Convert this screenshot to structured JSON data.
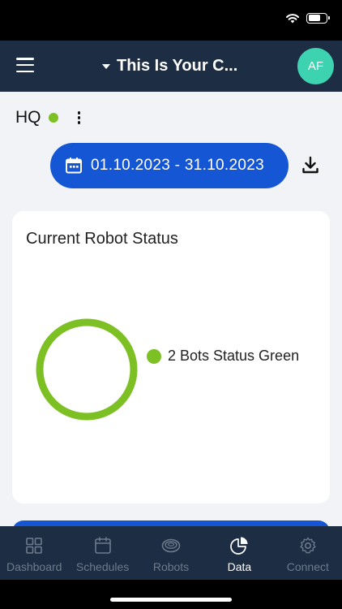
{
  "header": {
    "title": "This Is Your C...",
    "avatar_initials": "AF"
  },
  "location": {
    "name": "HQ",
    "status_color": "#7cc024"
  },
  "date_range": {
    "label": "01.10.2023 - 31.10.2023",
    "icon": "calendar-icon"
  },
  "robot_status_card": {
    "title": "Current Robot Status",
    "legend": [
      {
        "label": "2 Bots Status Green",
        "color": "#7cc024"
      }
    ]
  },
  "chart_data": {
    "type": "pie",
    "variant": "donut",
    "title": "Current Robot Status",
    "categories": [
      "2 Bots Status Green"
    ],
    "values": [
      2
    ],
    "colors": [
      "#7cc024"
    ]
  },
  "tabs": [
    {
      "label": "Dashboard",
      "icon": "dashboard-icon",
      "active": false
    },
    {
      "label": "Schedules",
      "icon": "calendar-icon",
      "active": false
    },
    {
      "label": "Robots",
      "icon": "robot-vacuum-icon",
      "active": false
    },
    {
      "label": "Data",
      "icon": "pie-chart-icon",
      "active": true
    },
    {
      "label": "Connect",
      "icon": "gear-icon",
      "active": false
    }
  ],
  "colors": {
    "navy": "#1d2d44",
    "accent_blue": "#1556d4",
    "status_green": "#7cc024",
    "avatar_teal": "#3ed3b0"
  }
}
